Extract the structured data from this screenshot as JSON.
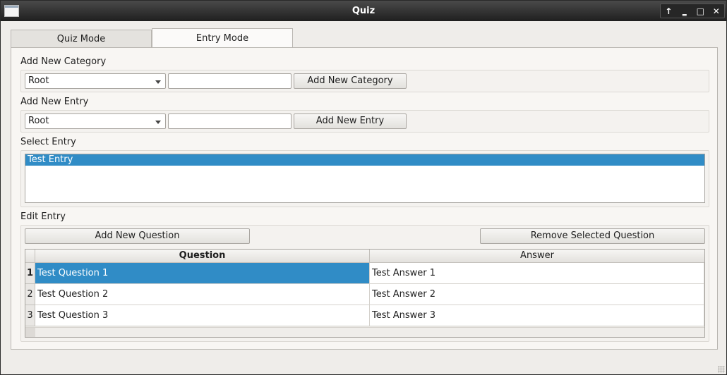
{
  "window": {
    "title": "Quiz",
    "buttons": {
      "keep_above": "↑",
      "minimize": "‗",
      "maximize": "□",
      "close": "✕"
    }
  },
  "tabs": [
    {
      "label": "Quiz Mode",
      "active": false
    },
    {
      "label": "Entry Mode",
      "active": true
    }
  ],
  "add_category": {
    "label": "Add New Category",
    "combo_value": "Root",
    "input_value": "",
    "button_label": "Add New Category"
  },
  "add_entry": {
    "label": "Add New Entry",
    "combo_value": "Root",
    "input_value": "",
    "button_label": "Add New Entry"
  },
  "select_entry": {
    "label": "Select Entry",
    "items": [
      {
        "label": "Test Entry",
        "selected": true
      }
    ]
  },
  "edit_entry": {
    "label": "Edit Entry",
    "add_button_label": "Add New Question",
    "remove_button_label": "Remove Selected Question",
    "table": {
      "headers": [
        "Question",
        "Answer"
      ],
      "rows": [
        {
          "num": "1",
          "question": "Test Question 1",
          "answer": "Test Answer 1"
        },
        {
          "num": "2",
          "question": "Test Question 2",
          "answer": "Test Answer 2"
        },
        {
          "num": "3",
          "question": "Test Question 3",
          "answer": "Test Answer 3"
        }
      ]
    }
  },
  "colors": {
    "selection": "#308cc6",
    "window_bg": "#efedea",
    "titlebar": "#2b2b2b"
  }
}
